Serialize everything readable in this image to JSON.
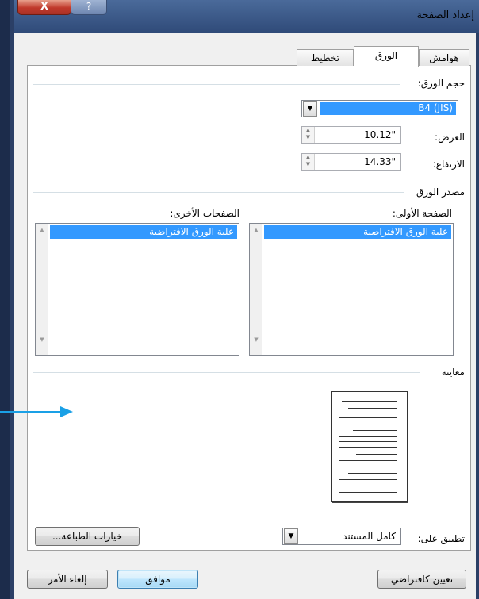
{
  "window": {
    "title": "إعداد الصفحة",
    "close_glyph": "X",
    "help_glyph": "?"
  },
  "tabs": [
    {
      "label": "هوامش",
      "active": false
    },
    {
      "label": "الورق",
      "active": true
    },
    {
      "label": "تخطيط",
      "active": false
    }
  ],
  "paper_size": {
    "heading": "حجم الورق:",
    "selected": "B4 (JIS)",
    "width_label": "العرض:",
    "width_value": "10.12\"",
    "height_label": "الارتفاع:",
    "height_value": "14.33\""
  },
  "paper_source": {
    "heading": "مصدر الورق",
    "first_page_label": "الصفحة الأولى:",
    "first_page_selected": "علبة الورق الافتراضية",
    "other_pages_label": "الصفحات الأخرى:",
    "other_pages_selected": "علبة الورق الافتراضية"
  },
  "preview": {
    "heading": "معاينة"
  },
  "apply": {
    "label": "تطبيق على:",
    "value": "كامل المستند"
  },
  "buttons": {
    "print_options": "خيارات الطباعة...",
    "set_default": "تعيين كافتراضي",
    "ok": "موافق",
    "cancel": "إلغاء الأمر"
  },
  "colors": {
    "selection": "#3399ff",
    "annotation_arrow": "#1aa0e6"
  }
}
